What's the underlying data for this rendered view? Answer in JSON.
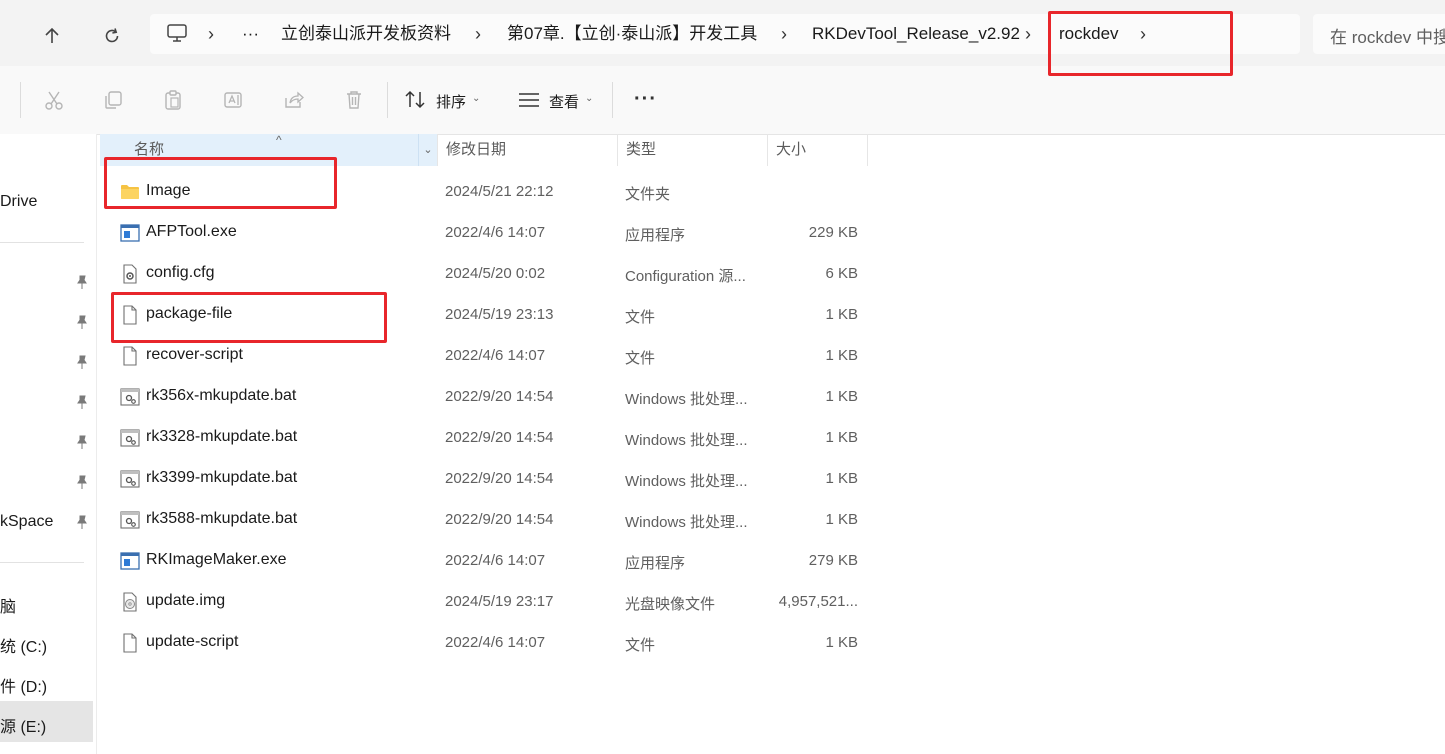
{
  "nav": {
    "breadcrumbs": [
      "立创泰山派开发板资料",
      "第07章.【立创·泰山派】开发工具",
      "RKDevTool_Release_v2.92",
      "rockdev"
    ],
    "ellipsis": "···",
    "search_placeholder": "在 rockdev 中搜索"
  },
  "toolbar": {
    "sort_label": "排序",
    "view_label": "查看",
    "more_label": "···"
  },
  "sidebar": {
    "items": [
      "Drive",
      "kSpace",
      "脑",
      "统 (C:)",
      "件 (D:)",
      "源 (E:)"
    ]
  },
  "columns": {
    "name": "名称",
    "date": "修改日期",
    "type": "类型",
    "size": "大小"
  },
  "files": [
    {
      "name": "Image",
      "date": "2024/5/21 22:12",
      "type": "文件夹",
      "size": "",
      "icon": "folder-icon"
    },
    {
      "name": "AFPTool.exe",
      "date": "2022/4/6 14:07",
      "type": "应用程序",
      "size": "229 KB",
      "icon": "exe-icon"
    },
    {
      "name": "config.cfg",
      "date": "2024/5/20 0:02",
      "type": "Configuration 源...",
      "size": "6 KB",
      "icon": "config-file-icon"
    },
    {
      "name": "package-file",
      "date": "2024/5/19 23:13",
      "type": "文件",
      "size": "1 KB",
      "icon": "file-icon"
    },
    {
      "name": "recover-script",
      "date": "2022/4/6 14:07",
      "type": "文件",
      "size": "1 KB",
      "icon": "file-icon"
    },
    {
      "name": "rk356x-mkupdate.bat",
      "date": "2022/9/20 14:54",
      "type": "Windows 批处理...",
      "size": "1 KB",
      "icon": "batch-file-icon"
    },
    {
      "name": "rk3328-mkupdate.bat",
      "date": "2022/9/20 14:54",
      "type": "Windows 批处理...",
      "size": "1 KB",
      "icon": "batch-file-icon"
    },
    {
      "name": "rk3399-mkupdate.bat",
      "date": "2022/9/20 14:54",
      "type": "Windows 批处理...",
      "size": "1 KB",
      "icon": "batch-file-icon"
    },
    {
      "name": "rk3588-mkupdate.bat",
      "date": "2022/9/20 14:54",
      "type": "Windows 批处理...",
      "size": "1 KB",
      "icon": "batch-file-icon"
    },
    {
      "name": "RKImageMaker.exe",
      "date": "2022/4/6 14:07",
      "type": "应用程序",
      "size": "279 KB",
      "icon": "exe-icon"
    },
    {
      "name": "update.img",
      "date": "2024/5/19 23:17",
      "type": "光盘映像文件",
      "size": "4,957,521...",
      "icon": "disc-image-icon"
    },
    {
      "name": "update-script",
      "date": "2022/4/6 14:07",
      "type": "文件",
      "size": "1 KB",
      "icon": "file-icon"
    }
  ],
  "colors": {
    "highlight_box": "#e8262b",
    "folder": "#f6c343",
    "selected_sidebar": "#e5e5e5"
  }
}
